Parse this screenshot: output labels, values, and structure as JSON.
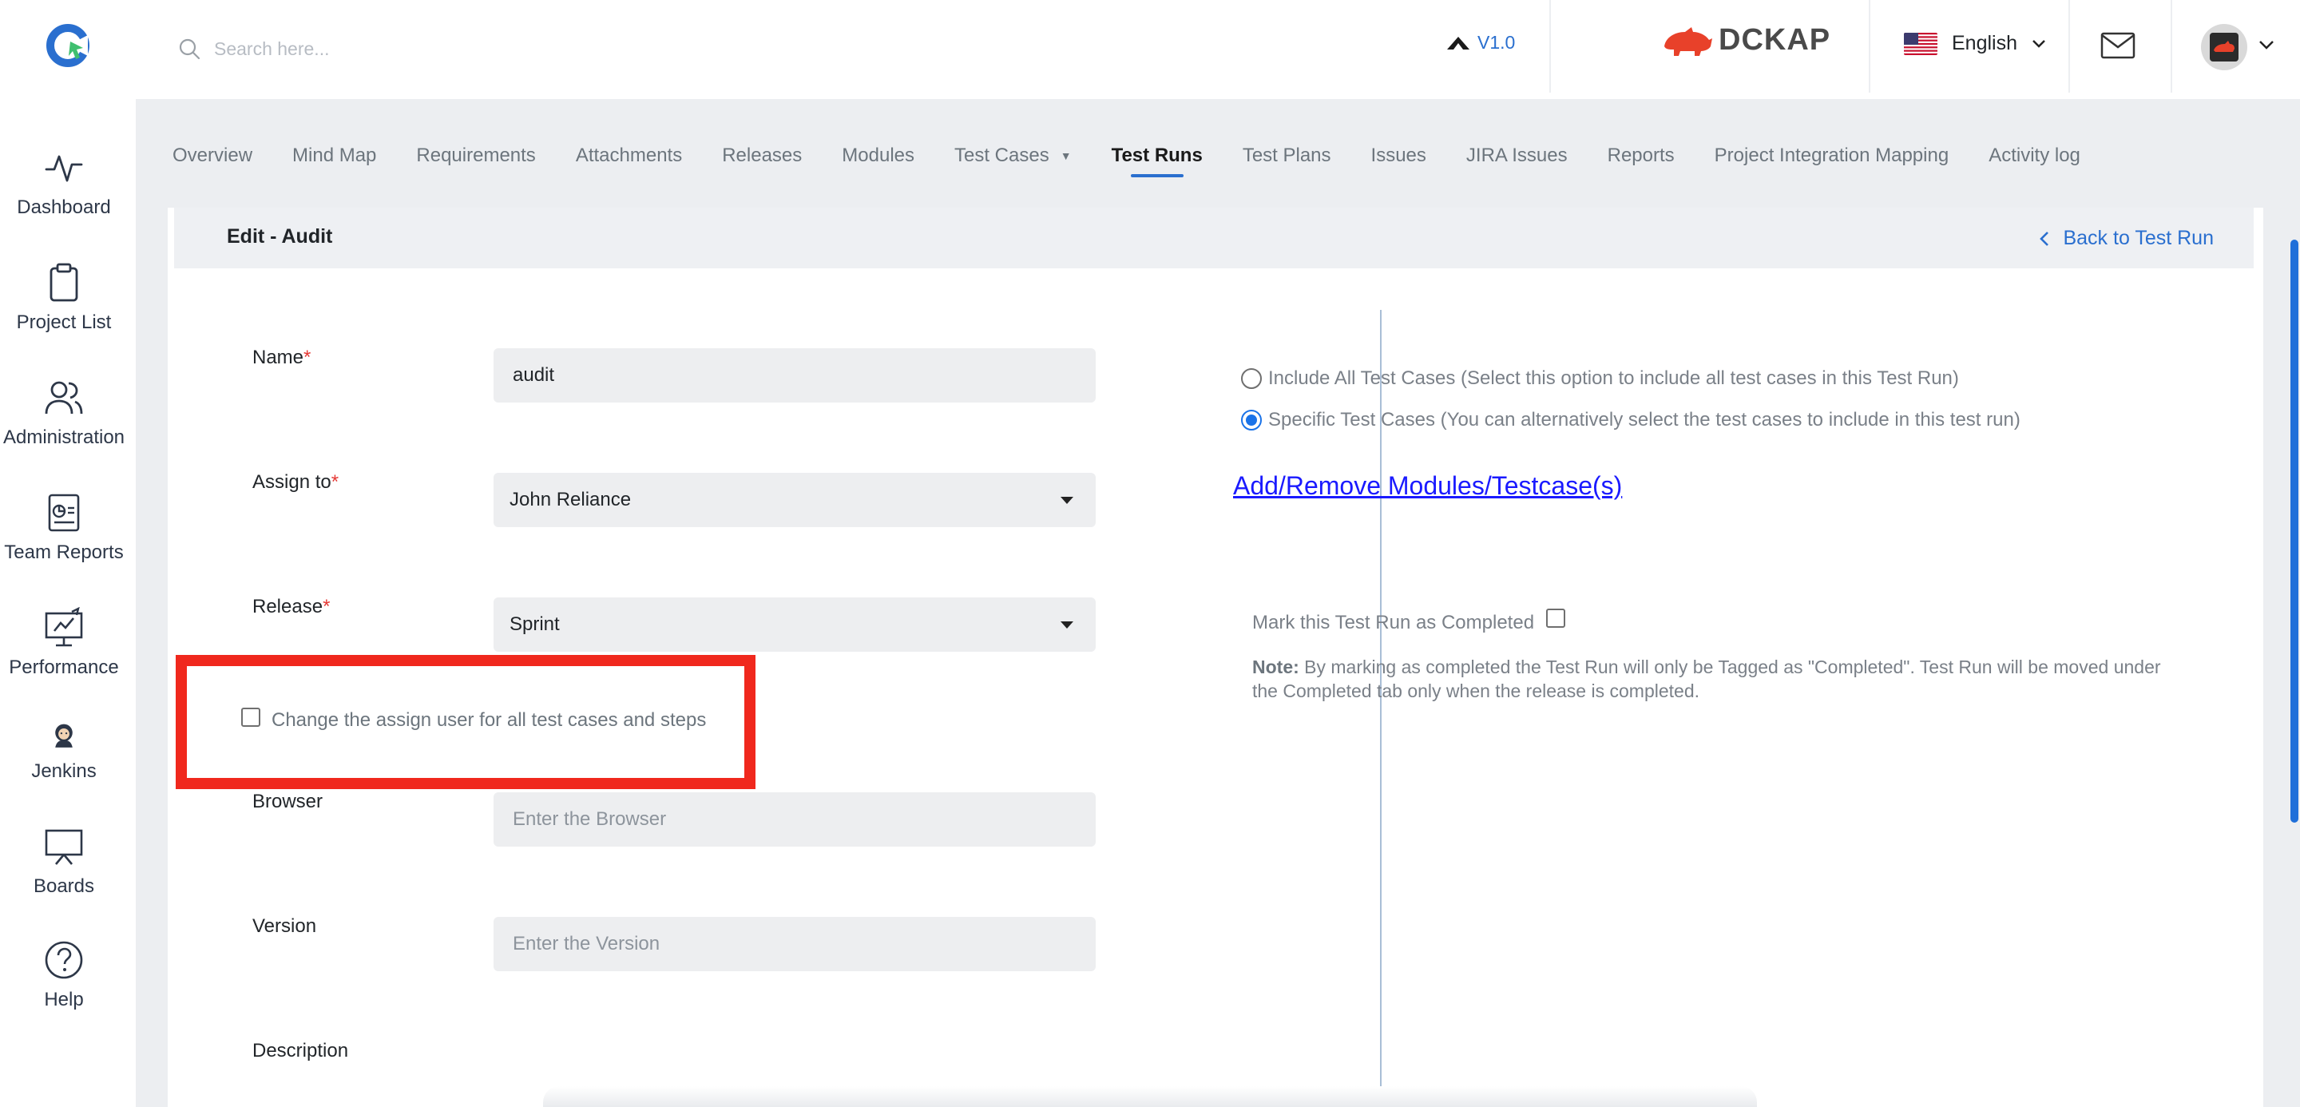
{
  "topbar": {
    "search_placeholder": "Search here...",
    "version": "V1.0",
    "brand": "DCKAP",
    "language": "English",
    "avatar_text": "DCKAP"
  },
  "sidebar": {
    "items": [
      {
        "label": "Dashboard",
        "icon": "activity-icon"
      },
      {
        "label": "Project List",
        "icon": "clipboard-icon"
      },
      {
        "label": "Administration",
        "icon": "users-icon"
      },
      {
        "label": "Team Reports",
        "icon": "report-icon"
      },
      {
        "label": "Performance",
        "icon": "presentation-icon"
      },
      {
        "label": "Jenkins",
        "icon": "jenkins-icon"
      },
      {
        "label": "Boards",
        "icon": "board-icon"
      },
      {
        "label": "Help",
        "icon": "help-icon"
      }
    ]
  },
  "tabs": [
    {
      "label": "Overview"
    },
    {
      "label": "Mind Map"
    },
    {
      "label": "Requirements"
    },
    {
      "label": "Attachments"
    },
    {
      "label": "Releases"
    },
    {
      "label": "Modules"
    },
    {
      "label": "Test Cases"
    },
    {
      "label": "Test Runs",
      "active": true
    },
    {
      "label": "Test Plans"
    },
    {
      "label": "Issues"
    },
    {
      "label": "JIRA Issues"
    },
    {
      "label": "Reports"
    },
    {
      "label": "Project Integration Mapping"
    },
    {
      "label": "Activity log"
    }
  ],
  "header": {
    "title": "Edit - Audit",
    "back_label": "Back to Test Run"
  },
  "form": {
    "name_label": "Name",
    "name_value": "audit",
    "assign_label": "Assign to",
    "assign_value": "John Reliance",
    "release_label": "Release",
    "release_value": "Sprint",
    "change_assign_label": "Change the assign user for all test cases and steps",
    "change_assign_checked": false,
    "browser_label": "Browser",
    "browser_placeholder": "Enter the Browser",
    "version_label": "Version",
    "version_placeholder": "Enter the Version",
    "description_label": "Description",
    "required_mark": "*"
  },
  "right": {
    "include_all_label": "Include All Test Cases (Select this option to include all test cases in this Test Run)",
    "specific_label": "Specific Test Cases (You can alternatively select the test cases to include in this test run)",
    "selected_option": "specific",
    "modules_link": "Add/Remove Modules/Testcase(s)",
    "mark_completed_label": "Mark this Test Run as Completed",
    "note_label": "Note:",
    "note_text": "By marking as completed the Test Run will only be Tagged as \"Completed\". Test Run will be moved under the Completed tab only when the release is completed."
  },
  "colors": {
    "accent": "#2a6fcf",
    "highlight": "#f0281d",
    "required": "#e53935",
    "link": "#1a1aff"
  }
}
